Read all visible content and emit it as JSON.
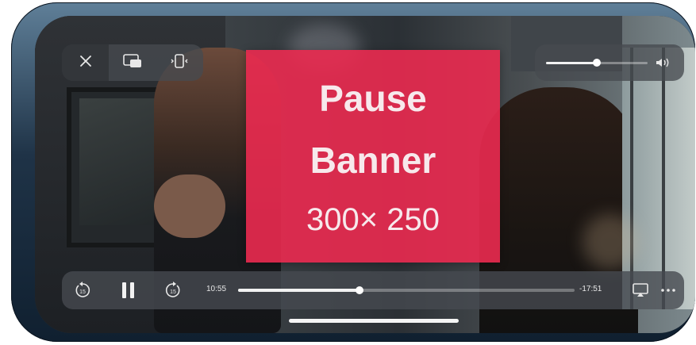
{
  "ad": {
    "line1": "Pause",
    "line2": "Banner",
    "line3": "300× 250"
  },
  "player": {
    "elapsed": "10:55",
    "remaining": "-17:51",
    "progress": 0.36,
    "volume": 0.5,
    "skip_back_seconds": "15",
    "skip_forward_seconds": "15"
  },
  "icons": {
    "close": "close-icon",
    "pip": "picture-in-picture-icon",
    "rotate": "rotation-lock-icon",
    "volume": "speaker-icon",
    "airplay": "airplay-icon",
    "more": "more-icon",
    "pause": "pause-icon"
  },
  "colors": {
    "banner": "#eb2a50",
    "banner_text": "#f7e9ec",
    "controls_bg": "#464a50"
  }
}
